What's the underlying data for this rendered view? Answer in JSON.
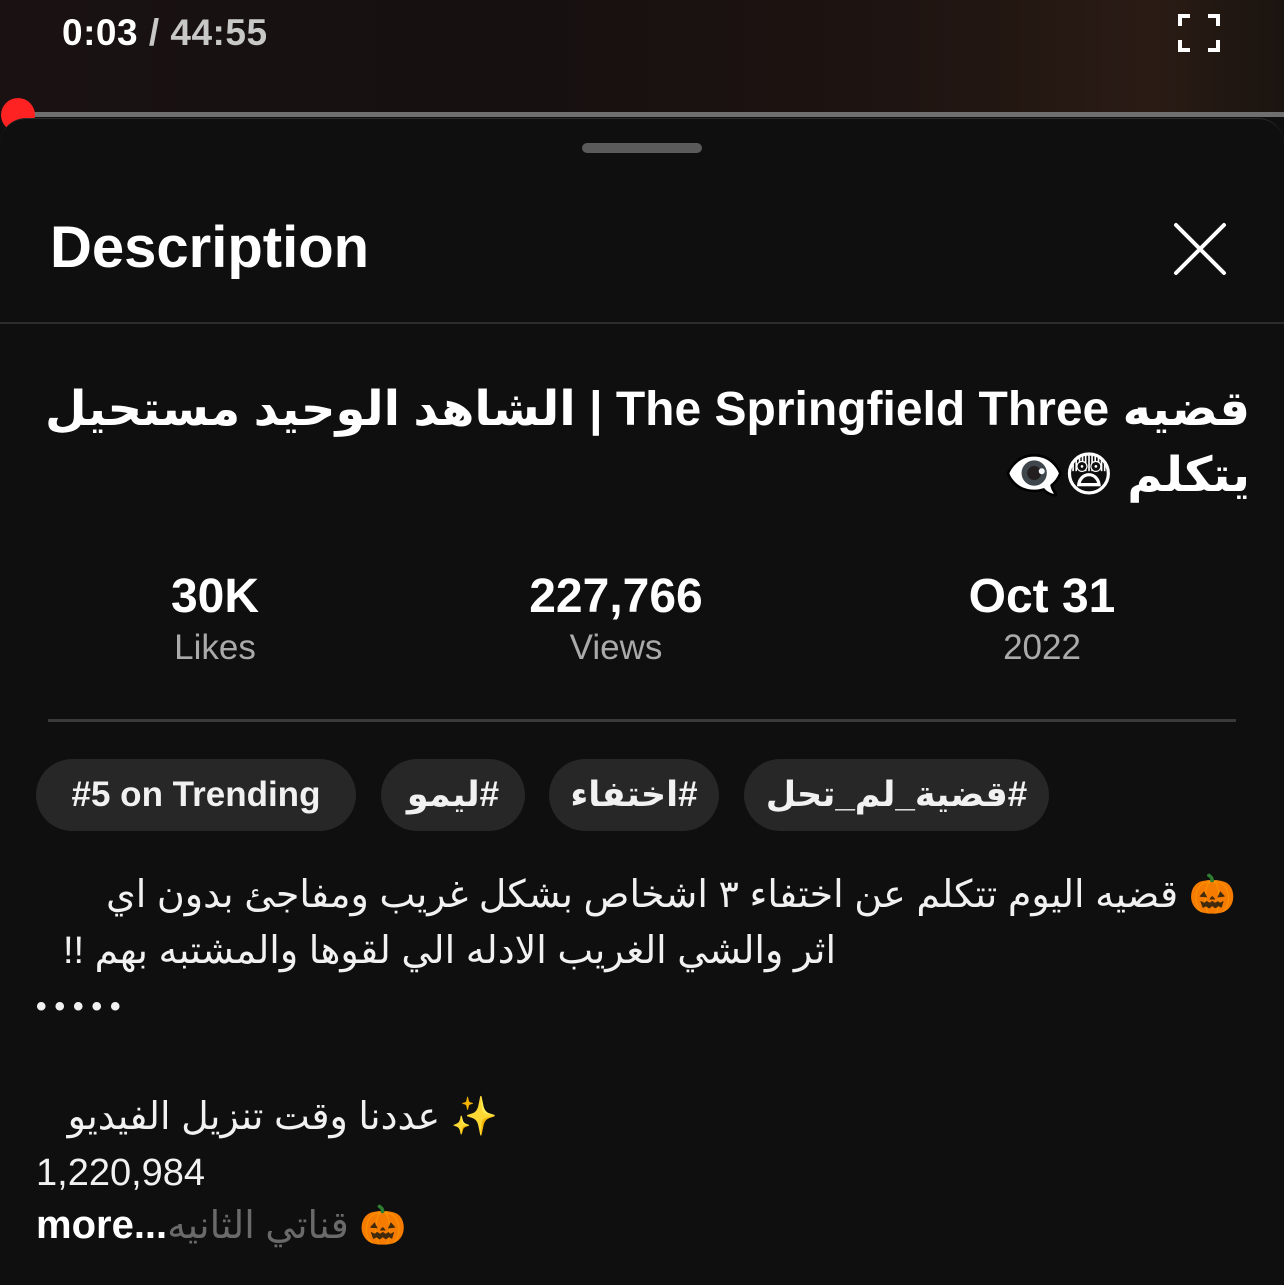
{
  "player": {
    "current_time": "0:03",
    "separator": " / ",
    "duration": "44:55",
    "progress_fraction": 0.0011,
    "accent_color": "#ff0000"
  },
  "sheet": {
    "title": "Description",
    "close_icon": "close-icon"
  },
  "video": {
    "title": "قضيه The Springfield Three | الشاهد الوحيد مستحيل يتكلم 😨👁️‍🗨️"
  },
  "stats": [
    {
      "value": "30K",
      "label": "Likes"
    },
    {
      "value": "227,766",
      "label": "Views"
    },
    {
      "value": "Oct 31",
      "label": "2022"
    }
  ],
  "chips": [
    {
      "label": "#5 on Trending"
    },
    {
      "label": "#ليمو"
    },
    {
      "label": "#اختفاء"
    },
    {
      "label": "#قضية_لم_تحل"
    }
  ],
  "description": {
    "line1": "🎃 قضيه اليوم تتكلم عن اختفاء ٣ اشخاص بشكل غريب ومفاجئ بدون اي",
    "line2": "اثر والشي الغريب الادله الي لقوها والمشتبه بهم !!",
    "line3": "•••••",
    "line4": "✨ عددنا وقت تنزيل الفيديو",
    "line5": "1,220,984",
    "line6": "🎃 قناتي الثانيه",
    "more": "more..."
  }
}
